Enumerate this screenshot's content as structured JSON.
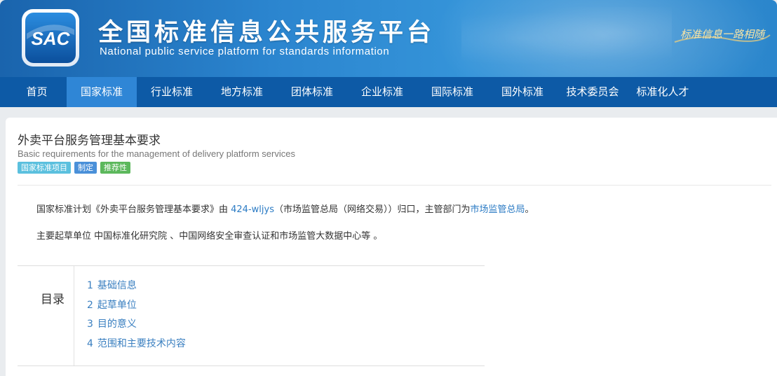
{
  "site": {
    "logo_text": "SAC",
    "title_cn": "全国标准信息公共服务平台",
    "title_en": "National public service platform  for standards information",
    "slogan": "标准信息一路相随"
  },
  "nav": {
    "items": [
      {
        "label": "首页",
        "active": false
      },
      {
        "label": "国家标准",
        "active": true
      },
      {
        "label": "行业标准",
        "active": false
      },
      {
        "label": "地方标准",
        "active": false
      },
      {
        "label": "团体标准",
        "active": false
      },
      {
        "label": "企业标准",
        "active": false
      },
      {
        "label": "国际标准",
        "active": false
      },
      {
        "label": "国外标准",
        "active": false
      },
      {
        "label": "技术委员会",
        "active": false
      },
      {
        "label": "标准化人才",
        "active": false
      }
    ]
  },
  "standard": {
    "title": "外卖平台服务管理基本要求",
    "title_en": "Basic requirements for the management of delivery platform services",
    "tags": [
      {
        "label": "国家标准项目",
        "color": "#5bc0de"
      },
      {
        "label": "制定",
        "color": "#4a90d9"
      },
      {
        "label": "推荐性",
        "color": "#5cb85c"
      }
    ],
    "summary": {
      "part1": "国家标准计划《外卖平台服务管理基本要求》由 ",
      "committee_link": "424-wljys",
      "part2": "（市场监管总局（网络交易））归口，主管部门为",
      "dept_link": "市场监管总局",
      "part3": "。"
    },
    "drafters": "主要起草单位 中国标准化研究院 、中国网络安全审查认证和市场监管大数据中心等 。"
  },
  "toc": {
    "heading": "目录",
    "items": [
      {
        "num": "1",
        "label": "基础信息"
      },
      {
        "num": "2",
        "label": "起草单位"
      },
      {
        "num": "3",
        "label": "目的意义"
      },
      {
        "num": "4",
        "label": "范围和主要技术内容"
      }
    ]
  }
}
